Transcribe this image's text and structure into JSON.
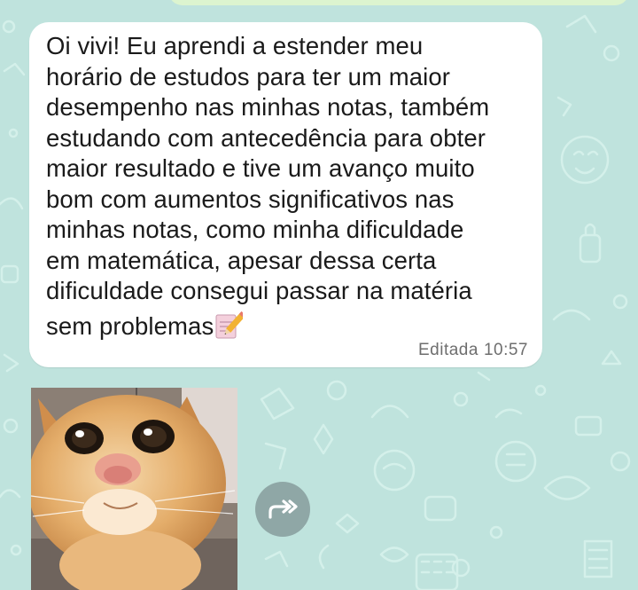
{
  "chat": {
    "message": {
      "lines": [
        "Oi vivi! Eu aprendi a estender meu",
        "horário de estudos para ter um maior",
        "desempenho nas minhas notas, também",
        "estudando com antecedência para obter",
        "maior resultado e tive um avanço muito",
        "bom com aumentos significativos nas",
        "minhas notas, como minha dificuldade",
        "em matemática, apesar dessa certa",
        "dificuldade consegui passar na matéria",
        "sem problemas"
      ],
      "emoji": "memo-icon",
      "edited_label": "Editada",
      "time": "10:57"
    },
    "photo": {
      "subject": "cat-photo"
    },
    "forward": {
      "icon": "forward-icon"
    }
  },
  "colors": {
    "wallpaper": "#bfe3dd",
    "bubble": "#ffffff",
    "outgoing_bubble": "#dcf4cf",
    "meta_text": "#6e6e6e",
    "forward_button": "#8fa7a6"
  }
}
